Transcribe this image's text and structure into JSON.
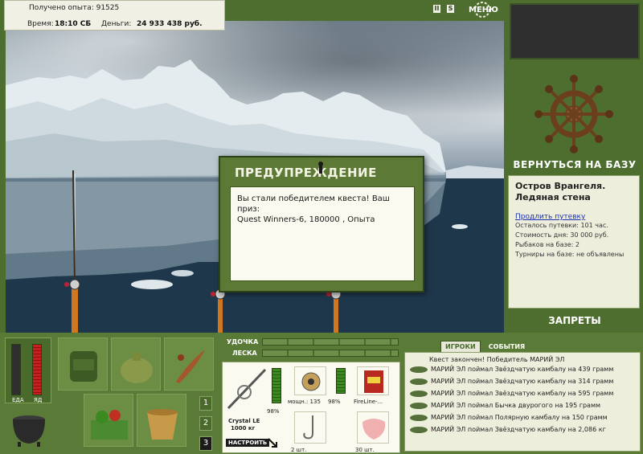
{
  "hud": {
    "exp_label": "Получено опыта: 91525",
    "time_label": "Время:",
    "time_value": "18:10 СБ",
    "money_label": "Деньги:",
    "money_value": "24 933 438 руб."
  },
  "top_buttons": {
    "pause": "II",
    "sound": "S",
    "menu": "МЕНЮ"
  },
  "right_panel": {
    "return_button": "ВЕРНУТЬСЯ НА БАЗУ",
    "location_title": "Остров Врангеля. Ледяная стена",
    "extend_link": "Продлить путевку",
    "rows": [
      "Осталось путевки: 101 час.",
      "Стоимость дня: 30 000 руб.",
      "Рыбаков на базе: 2",
      "Турниры на базе: не объявлены"
    ],
    "bans_button": "ЗАПРЕТЫ"
  },
  "dialog": {
    "title": "ПРЕДУПРЕЖДЕНИЕ",
    "line1": "Вы стали победителем квеста! Ваш приз:",
    "line2": "Quest Winners-6, 180000 , Опыта"
  },
  "bottom": {
    "food_label": "ЕДА",
    "poison_label": "ЯД",
    "rod_label": "УДОЧКА",
    "line_label": "ЛЕСКА",
    "pages": [
      "1",
      "2",
      "3"
    ],
    "rod_name": "Crystal LE",
    "rod_sub": "1000 кг",
    "rod_pct": "98%",
    "tune_button": "НАСТРОИТЬ",
    "reel_power": "мощн.: 135",
    "reel_pct": "98%",
    "line_name": "FireLine-...",
    "hook_count": "2 шт.",
    "bait_count": "30 шт."
  },
  "log": {
    "tab_players": "ИГРОКИ",
    "tab_events": "СОБЫТИЯ",
    "header": "Квест закончен! Победитель МАРИЙ ЭЛ",
    "lines": [
      "МАРИЙ ЭЛ поймал Звёздчатую камбалу на 439 грамм",
      "МАРИЙ ЭЛ поймал Звёздчатую камбалу на 314 грамм",
      "МАРИЙ ЭЛ поймал Звёздчатую камбалу на 595 грамм",
      "МАРИЙ ЭЛ поймал Бычка двурогого на 195 грамм",
      "МАРИЙ ЭЛ поймал Полярную камбалу на 150 грамм",
      "МАРИЙ ЭЛ поймал Звёздчатую камбалу на 2,086 кг"
    ]
  },
  "colors": {
    "panel_green": "#5a7a38",
    "dialog_green": "#5c7a36",
    "link_blue": "#1a2fb0"
  }
}
